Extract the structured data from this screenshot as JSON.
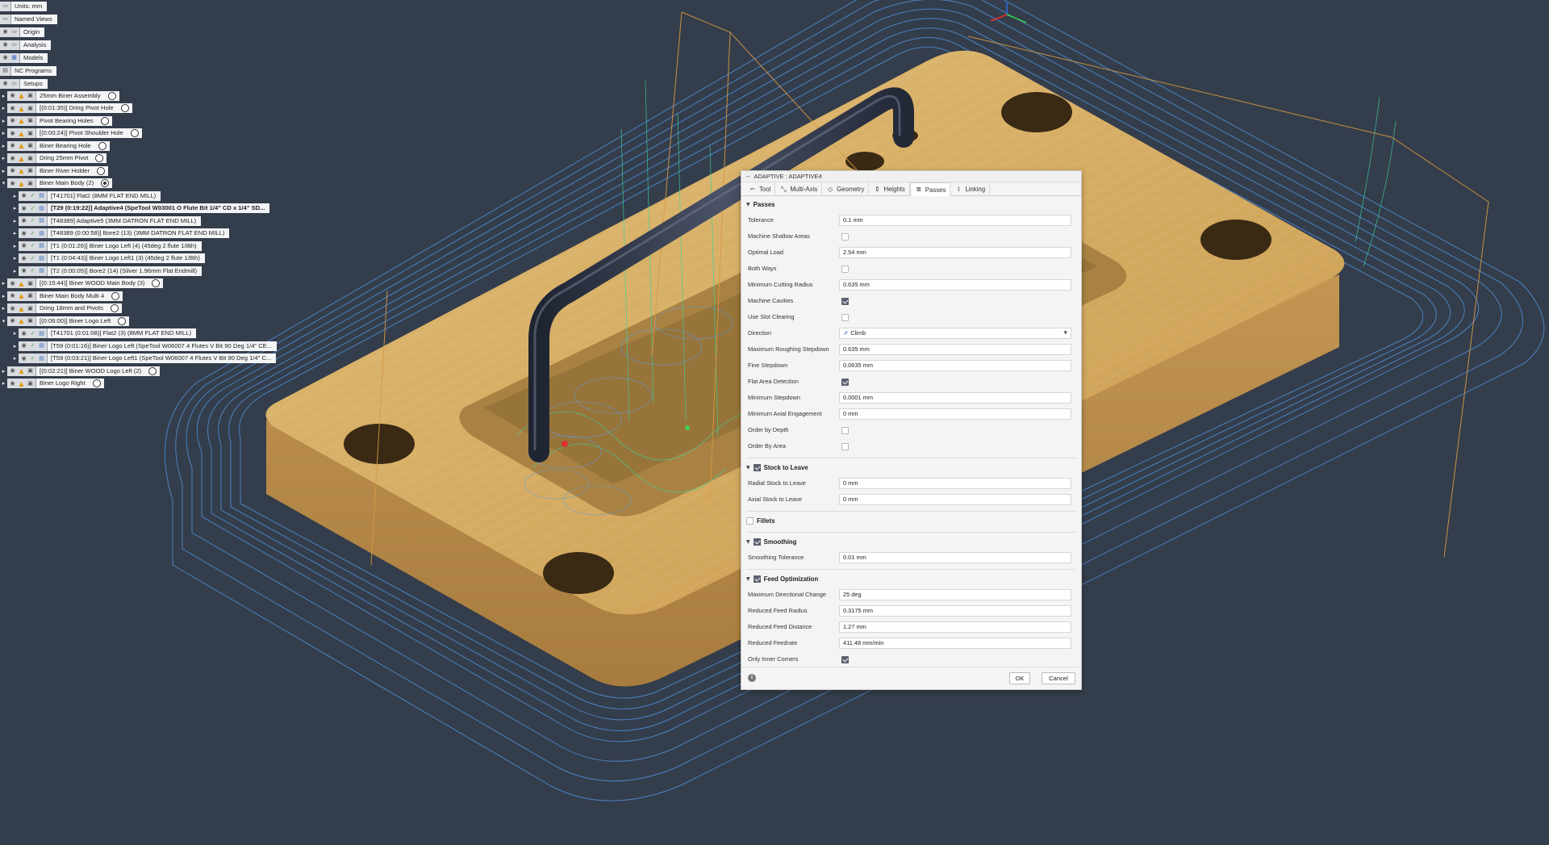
{
  "browser": {
    "top_items": [
      {
        "label": "Units: mm"
      },
      {
        "label": "Named Views"
      },
      {
        "label": "Origin"
      },
      {
        "label": "Analysis"
      },
      {
        "label": "Models"
      },
      {
        "label": "NC Programs"
      },
      {
        "label": "Setups"
      }
    ],
    "setups": [
      {
        "label": "25mm Biner Assembly",
        "level": 0,
        "expanded": false,
        "bold": false,
        "radio": "off"
      },
      {
        "label": "[(0:01:35)] Dring Pivot Hole",
        "level": 0,
        "expanded": false,
        "bold": false,
        "radio": "off"
      },
      {
        "label": "Pivot Bearing Holes",
        "level": 0,
        "expanded": false,
        "bold": false,
        "radio": "off"
      },
      {
        "label": "[(0:00:24)] Pivot Shoulder Hole",
        "level": 0,
        "expanded": false,
        "bold": false,
        "radio": "off"
      },
      {
        "label": "Biner Bearing Hole",
        "level": 0,
        "expanded": false,
        "bold": false,
        "radio": "off"
      },
      {
        "label": "Dring 25mm Pivot",
        "level": 0,
        "expanded": false,
        "bold": false,
        "radio": "off"
      },
      {
        "label": "Biner River Holder",
        "level": 0,
        "expanded": false,
        "bold": false,
        "radio": "off"
      },
      {
        "label": "Biner Main Body (2)",
        "level": 0,
        "expanded": true,
        "bold": false,
        "radio": "on"
      },
      {
        "label": "[T41701] Flat2 (8MM FLAT END MILL)",
        "level": 1,
        "expanded": false,
        "bold": false,
        "radio": "none"
      },
      {
        "label": "[T29 (0:19:22)] Adaptive4 (SpeTool W03001 O Flute Bit 1/4\" CD x 1/4\" SD...",
        "level": 1,
        "expanded": false,
        "bold": true,
        "radio": "none"
      },
      {
        "label": "[T48389] Adaptive5 (3MM DATRON FLAT END MILL)",
        "level": 1,
        "expanded": false,
        "bold": false,
        "radio": "none"
      },
      {
        "label": "[T48389 (0:00:58)] Bore2 (13) (3MM DATRON FLAT END MILL)",
        "level": 1,
        "expanded": false,
        "bold": false,
        "radio": "none"
      },
      {
        "label": "[T1 (0:01:26)] Biner Logo Left (4) (45deg 2 flute 1/8th)",
        "level": 1,
        "expanded": false,
        "bold": false,
        "radio": "none"
      },
      {
        "label": "[T1 (0:04:43)] Biner Logo Left1 (3) (45deg 2 flute 1/8th)",
        "level": 1,
        "expanded": false,
        "bold": false,
        "radio": "none"
      },
      {
        "label": "[T2 (0:00:05)] Bore2 (14) (Silver 1.96mm Flat Endmill)",
        "level": 1,
        "expanded": false,
        "bold": false,
        "radio": "none"
      },
      {
        "label": "[(0:15:44)] Biner WOOD Main Body (3)",
        "level": 0,
        "expanded": false,
        "bold": false,
        "radio": "off"
      },
      {
        "label": "Biner Main Body Multi 4",
        "level": 0,
        "expanded": false,
        "bold": false,
        "radio": "off"
      },
      {
        "label": "Dring 18mm and Pivots",
        "level": 0,
        "expanded": false,
        "bold": false,
        "radio": "off"
      },
      {
        "label": "[(0:06:00)] Biner Logo Left",
        "level": 0,
        "expanded": true,
        "bold": false,
        "radio": "off"
      },
      {
        "label": "[T41701 (0:01:08)] Flat2 (3) (8MM FLAT END MILL)",
        "level": 1,
        "expanded": false,
        "bold": false,
        "radio": "none"
      },
      {
        "label": "[T59 (0:01:16)] Biner Logo Left (SpeTool W06007 4 Flutes V Bit 90 Deg 1/4\" CE...",
        "level": 1,
        "expanded": false,
        "bold": false,
        "radio": "none"
      },
      {
        "label": "[T59 (0:03:21)] Biner Logo Left1 (SpeTool W06007 4 Flutes V Bit 90 Deg 1/4\" C...",
        "level": 1,
        "expanded": false,
        "bold": false,
        "radio": "none"
      },
      {
        "label": "[(0:02:21)] Biner WOOD  Logo Left (2)",
        "level": 0,
        "expanded": false,
        "bold": false,
        "radio": "off"
      },
      {
        "label": "Biner Logo Right",
        "level": 0,
        "expanded": false,
        "bold": false,
        "radio": "off"
      }
    ]
  },
  "dialog": {
    "title": "ADAPTIVE : ADAPTIVE4",
    "tabs": [
      {
        "label": "Tool",
        "icon": "tool-icon"
      },
      {
        "label": "Multi-Axis",
        "icon": "multi-axis-icon"
      },
      {
        "label": "Geometry",
        "icon": "geometry-icon"
      },
      {
        "label": "Heights",
        "icon": "heights-icon"
      },
      {
        "label": "Passes",
        "icon": "passes-icon",
        "active": true
      },
      {
        "label": "Linking",
        "icon": "linking-icon"
      }
    ],
    "sections": {
      "passes": "Passes",
      "stock": "Stock to Leave",
      "fillets": "Fillets",
      "smoothing": "Smoothing",
      "feed": "Feed Optimization"
    },
    "passes_params": [
      {
        "label": "Tolerance",
        "value": "0.1 mm",
        "kind": "text"
      },
      {
        "label": "Machine Shallow Areas",
        "checked": false,
        "kind": "check"
      },
      {
        "label": "Optimal Load",
        "value": "2.54 mm",
        "kind": "text"
      },
      {
        "label": "Both Ways",
        "checked": false,
        "kind": "check"
      },
      {
        "label": "Minimum Cutting Radius",
        "value": "0.635 mm",
        "kind": "text"
      },
      {
        "label": "Machine Cavities",
        "checked": true,
        "kind": "check"
      },
      {
        "label": "Use Slot Clearing",
        "checked": false,
        "kind": "check"
      },
      {
        "label": "Direction",
        "value": "Climb",
        "kind": "select"
      },
      {
        "label": "Maximum Roughing Stepdown",
        "value": "0.635 mm",
        "kind": "text"
      },
      {
        "label": "Fine Stepdown",
        "value": "0.0635 mm",
        "kind": "text"
      },
      {
        "label": "Flat Area Detection",
        "checked": true,
        "kind": "check"
      },
      {
        "label": "Minimum Stepdown",
        "value": "0.0001 mm",
        "kind": "text"
      },
      {
        "label": "Minimum Axial Engagement",
        "value": "0 mm",
        "kind": "text"
      },
      {
        "label": "Order by Depth",
        "checked": false,
        "kind": "check"
      },
      {
        "label": "Order By Area",
        "checked": false,
        "kind": "check"
      }
    ],
    "stock_params": [
      {
        "label": "Radial Stock to Leave",
        "value": "0 mm",
        "kind": "text"
      },
      {
        "label": "Axial Stock to Leave",
        "value": "0 mm",
        "kind": "text"
      }
    ],
    "smoothing_params": [
      {
        "label": "Smoothing Tolerance",
        "value": "0.01 mm",
        "kind": "text"
      }
    ],
    "feed_params": [
      {
        "label": "Maximum Directional Change",
        "value": "25 deg",
        "kind": "text"
      },
      {
        "label": "Reduced Feed Radius",
        "value": "0.3175 mm",
        "kind": "text"
      },
      {
        "label": "Reduced Feed Distance",
        "value": "1.27 mm",
        "kind": "text"
      },
      {
        "label": "Reduced Feedrate",
        "value": "411.48 mm/min",
        "kind": "text"
      },
      {
        "label": "Only Inner Corners",
        "checked": true,
        "kind": "check"
      }
    ],
    "stock_enabled": true,
    "fillets_enabled": false,
    "smoothing_enabled": true,
    "feed_enabled": true,
    "ok_label": "OK",
    "cancel_label": "Cancel",
    "info_glyph": "i"
  },
  "colors": {
    "background": "#343d4b",
    "wood": "#d7b06a",
    "toolpath_blue": "#4f8fd8",
    "toolpath_green": "#3ad39a",
    "handle": "#2e3444"
  }
}
